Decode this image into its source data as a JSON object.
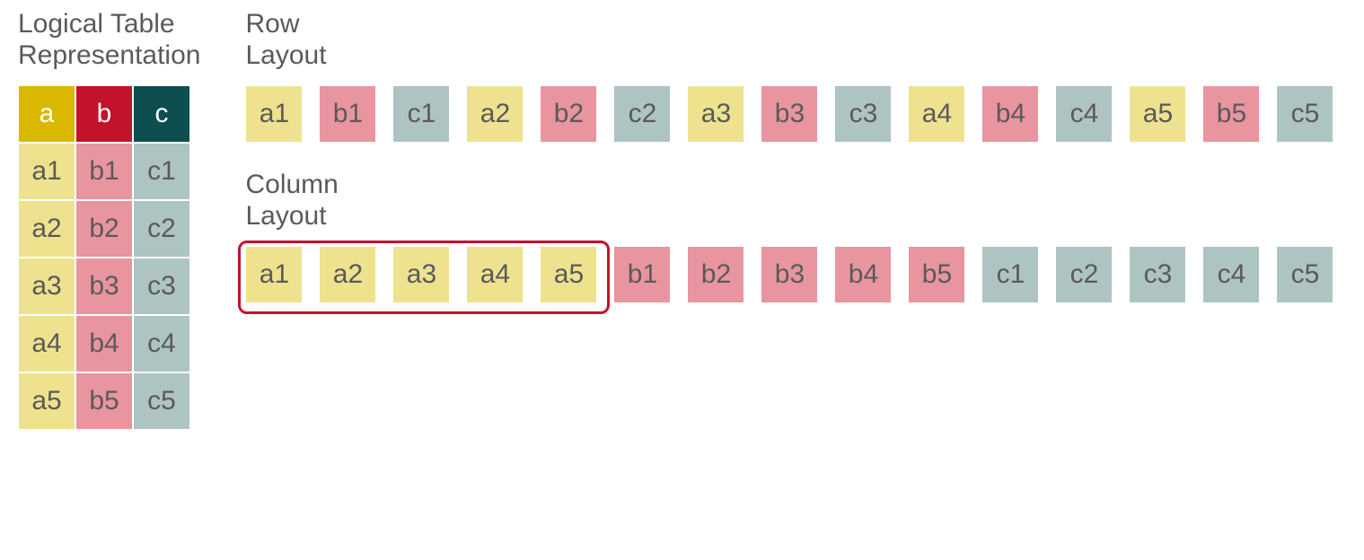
{
  "titles": {
    "logical": "Logical Table\nRepresentation",
    "row": "Row\nLayout",
    "column": "Column\nLayout"
  },
  "columns": [
    "a",
    "b",
    "c"
  ],
  "rows": 5,
  "logical_table": {
    "headers": [
      {
        "label": "a",
        "class": "col-a"
      },
      {
        "label": "b",
        "class": "col-b"
      },
      {
        "label": "c",
        "class": "col-c"
      }
    ],
    "body": [
      [
        {
          "label": "a1",
          "class": "cell-a"
        },
        {
          "label": "b1",
          "class": "cell-b"
        },
        {
          "label": "c1",
          "class": "cell-c"
        }
      ],
      [
        {
          "label": "a2",
          "class": "cell-a"
        },
        {
          "label": "b2",
          "class": "cell-b"
        },
        {
          "label": "c2",
          "class": "cell-c"
        }
      ],
      [
        {
          "label": "a3",
          "class": "cell-a"
        },
        {
          "label": "b3",
          "class": "cell-b"
        },
        {
          "label": "c3",
          "class": "cell-c"
        }
      ],
      [
        {
          "label": "a4",
          "class": "cell-a"
        },
        {
          "label": "b4",
          "class": "cell-b"
        },
        {
          "label": "c4",
          "class": "cell-c"
        }
      ],
      [
        {
          "label": "a5",
          "class": "cell-a"
        },
        {
          "label": "b5",
          "class": "cell-b"
        },
        {
          "label": "c5",
          "class": "cell-c"
        }
      ]
    ]
  },
  "row_layout": [
    {
      "label": "a1",
      "class": "cell-a"
    },
    {
      "label": "b1",
      "class": "cell-b"
    },
    {
      "label": "c1",
      "class": "cell-c"
    },
    {
      "label": "a2",
      "class": "cell-a"
    },
    {
      "label": "b2",
      "class": "cell-b"
    },
    {
      "label": "c2",
      "class": "cell-c"
    },
    {
      "label": "a3",
      "class": "cell-a"
    },
    {
      "label": "b3",
      "class": "cell-b"
    },
    {
      "label": "c3",
      "class": "cell-c"
    },
    {
      "label": "a4",
      "class": "cell-a"
    },
    {
      "label": "b4",
      "class": "cell-b"
    },
    {
      "label": "c4",
      "class": "cell-c"
    },
    {
      "label": "a5",
      "class": "cell-a"
    },
    {
      "label": "b5",
      "class": "cell-b"
    },
    {
      "label": "c5",
      "class": "cell-c"
    }
  ],
  "column_layout": [
    {
      "label": "a1",
      "class": "cell-a"
    },
    {
      "label": "a2",
      "class": "cell-a"
    },
    {
      "label": "a3",
      "class": "cell-a"
    },
    {
      "label": "a4",
      "class": "cell-a"
    },
    {
      "label": "a5",
      "class": "cell-a"
    },
    {
      "label": "b1",
      "class": "cell-b"
    },
    {
      "label": "b2",
      "class": "cell-b"
    },
    {
      "label": "b3",
      "class": "cell-b"
    },
    {
      "label": "b4",
      "class": "cell-b"
    },
    {
      "label": "b5",
      "class": "cell-b"
    },
    {
      "label": "c1",
      "class": "cell-c"
    },
    {
      "label": "c2",
      "class": "cell-c"
    },
    {
      "label": "c3",
      "class": "cell-c"
    },
    {
      "label": "c4",
      "class": "cell-c"
    },
    {
      "label": "c5",
      "class": "cell-c"
    }
  ],
  "highlight": {
    "col": "a",
    "count": 5
  }
}
